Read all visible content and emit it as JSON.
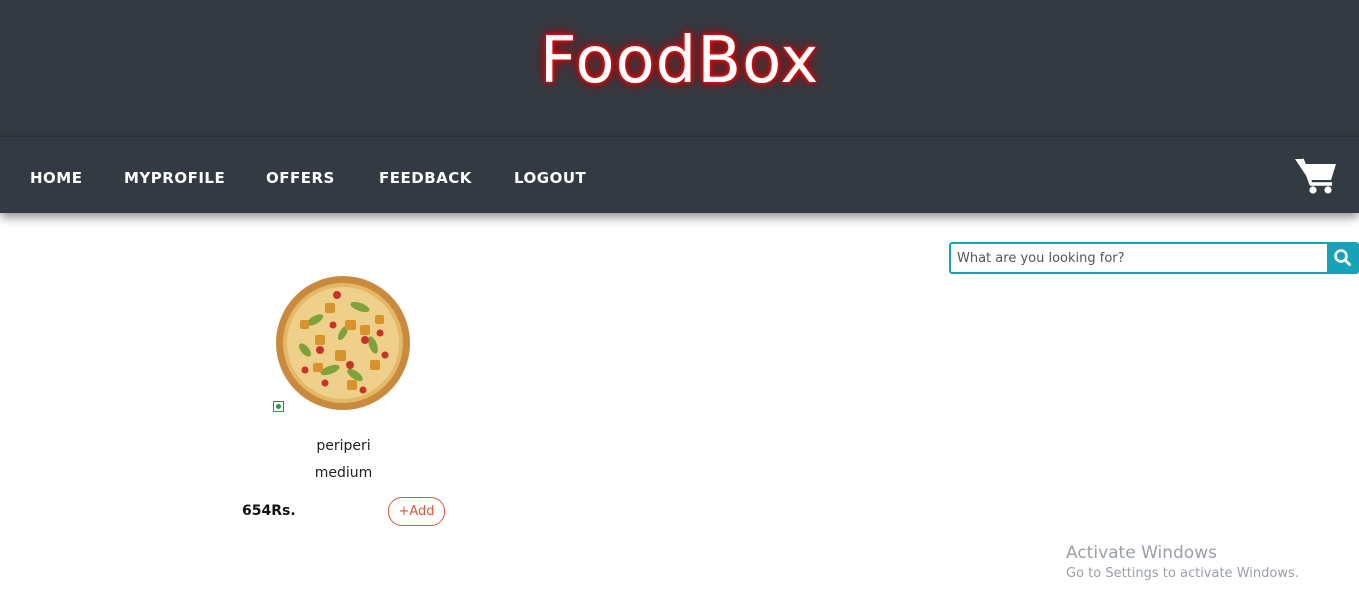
{
  "header": {
    "brand": "FoodBox"
  },
  "nav": {
    "items": [
      {
        "label": "HOME"
      },
      {
        "label": "MYPROFILE"
      },
      {
        "label": "OFFERS"
      },
      {
        "label": "FEEDBACK"
      },
      {
        "label": "LOGOUT"
      }
    ],
    "cart_icon": "shopping-cart-icon"
  },
  "search": {
    "placeholder": "What are you looking for?",
    "value": "",
    "button_icon": "search-icon"
  },
  "products": [
    {
      "name": "periperi",
      "size": "medium",
      "price": "654Rs.",
      "add_label": "+Add",
      "veg": true,
      "image_icon": "pizza-image"
    }
  ],
  "watermark": {
    "title": "Activate Windows",
    "subtitle": "Go to Settings to activate Windows."
  },
  "colors": {
    "header_bg": "#343a42",
    "accent": "#17a2b8",
    "add_button": "#e0563b",
    "brand_glow": "#d00000",
    "veg": "#1e9e3c"
  }
}
